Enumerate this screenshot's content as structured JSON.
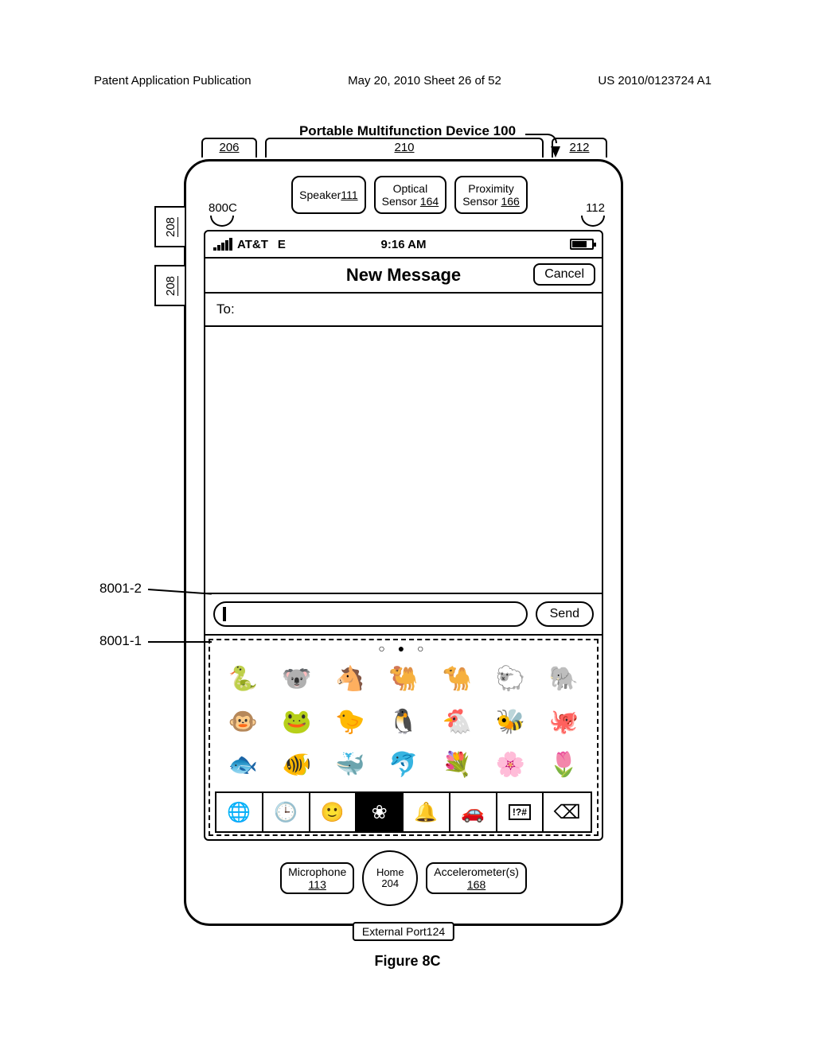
{
  "header": {
    "left": "Patent Application Publication",
    "center": "May 20, 2010  Sheet 26 of 52",
    "right": "US 2010/0123724 A1"
  },
  "device_title": "Portable Multifunction Device 100",
  "top_refs": {
    "a": "206",
    "b": "210",
    "c": "212"
  },
  "side_refs": {
    "a": "208",
    "b": "208"
  },
  "hw_top": {
    "speaker": "Speaker",
    "speaker_ref": "111",
    "optical_l1": "Optical",
    "optical_l2": "Sensor ",
    "optical_ref": "164",
    "prox_l1": "Proximity",
    "prox_l2": "Sensor ",
    "prox_ref": "166"
  },
  "ref_800c": "800C",
  "ref_112": "112",
  "status": {
    "carrier": "AT&T",
    "net": "E",
    "time": "9:16 AM"
  },
  "nav": {
    "title": "New Message",
    "cancel": "Cancel"
  },
  "to_label": "To:",
  "send_label": "Send",
  "page_dots": "○ ● ○",
  "emoji_rows": [
    [
      "🐍",
      "🐨",
      "🐴",
      "🐫",
      "🐪",
      "🐑",
      "🐘"
    ],
    [
      "🐵",
      "🐸",
      "🐤",
      "🐧",
      "🐔",
      "🐝",
      "🐙"
    ],
    [
      "🐟",
      "🐠",
      "🐳",
      "🐬",
      "💐",
      "🌸",
      "🌷"
    ]
  ],
  "categories": {
    "globe": "🌐",
    "recent": "🕒",
    "faces": "🙂",
    "nature": "❀",
    "objects": "🔔",
    "places": "🚗",
    "symbols": "!?#",
    "del": "⌫"
  },
  "callouts": {
    "a": "8001-2",
    "b": "8001-1"
  },
  "hw_bottom": {
    "mic": "Microphone",
    "mic_ref": "113",
    "home": "Home",
    "home_ref": "204",
    "accel": "Accelerometer(s)",
    "accel_ref": "168"
  },
  "ext_port": "External Port",
  "ext_port_ref": "124",
  "figure": "Figure 8C"
}
